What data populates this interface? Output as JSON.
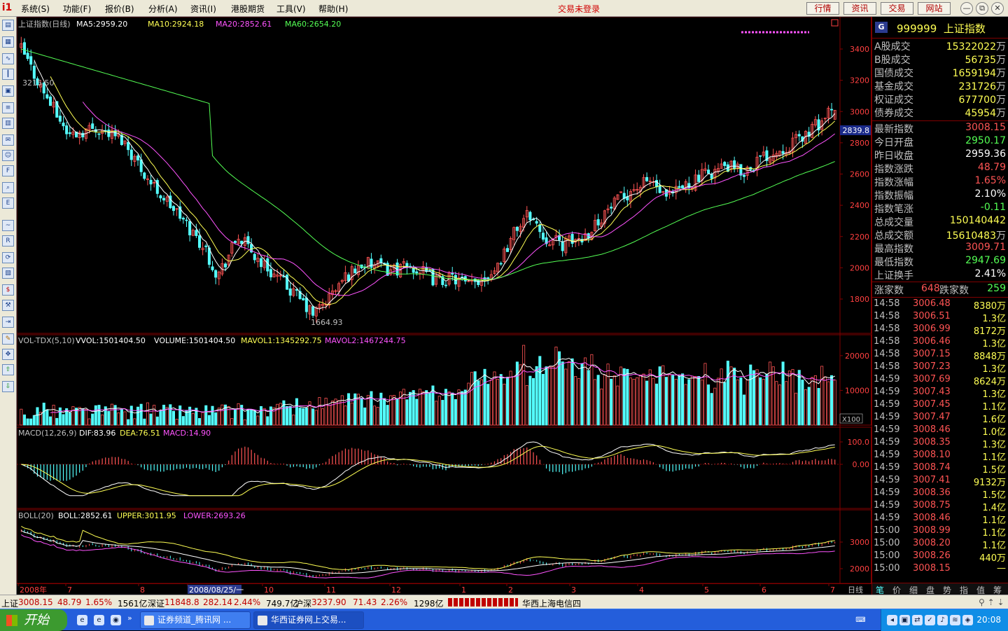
{
  "app": {
    "logo": "i1",
    "status": "交易未登录"
  },
  "menu": [
    "系统(S)",
    "功能(F)",
    "报价(B)",
    "分析(A)",
    "资讯(I)",
    "港股期货",
    "工具(V)",
    "帮助(H)"
  ],
  "top_buttons": [
    "行情",
    "资讯",
    "交易",
    "网站"
  ],
  "window_buttons": {
    "minimize": "—",
    "restore": "⧉",
    "close": "✕"
  },
  "charts": {
    "kline": {
      "title": "上证指数(日线)",
      "ma5": "MA5:2959.20",
      "ma10": "MA10:2924.18",
      "ma20": "MA20:2852.61",
      "ma60": "MA60:2654.20",
      "yticks": [
        "3400",
        "3200",
        "3000",
        "2800",
        "2600",
        "2400",
        "2200",
        "2000",
        "1800"
      ],
      "high_label": "3215.50",
      "low_label": "1664.93",
      "current_price": "2839.8"
    },
    "vol": {
      "title": "VOL-TDX(5,10)",
      "vvol": "VVOL:1501404.50",
      "volume": "VOLUME:1501404.50",
      "mavol1": "MAVOL1:1345292.75",
      "mavol2": "MAVOL2:1467244.75",
      "yticks": [
        "20000",
        "10000"
      ],
      "unit": "X100"
    },
    "macd": {
      "title": "MACD(12,26,9)",
      "dif": "DIF:83.96",
      "dea": "DEA:76.51",
      "macd": "MACD:14.90",
      "yticks": [
        "100.0",
        "0.00"
      ]
    },
    "boll": {
      "title": "BOLL(20)",
      "boll": "BOLL:2852.61",
      "upper": "UPPER:3011.95",
      "lower": "LOWER:2693.26",
      "yticks": [
        "3000",
        "2000"
      ]
    },
    "xaxis": {
      "labels": [
        "2008年",
        "7",
        "8",
        "2008/08/25/一",
        "10",
        "11",
        "12",
        "1",
        "2",
        "3",
        "4",
        "5",
        "6",
        "7"
      ],
      "period": "日线"
    }
  },
  "panel": {
    "code": "999999",
    "name": "上证指数",
    "volumes": [
      {
        "label": "A股成交",
        "value": "15322022",
        "unit": "万"
      },
      {
        "label": "B股成交",
        "value": "56735",
        "unit": "万"
      },
      {
        "label": "国债成交",
        "value": "1659194",
        "unit": "万"
      },
      {
        "label": "基金成交",
        "value": "231726",
        "unit": "万"
      },
      {
        "label": "权证成交",
        "value": "677700",
        "unit": "万"
      },
      {
        "label": "债券成交",
        "value": "45954",
        "unit": "万"
      }
    ],
    "stats": [
      {
        "label": "最新指数",
        "value": "3008.15",
        "color": "#ff5454"
      },
      {
        "label": "今日开盘",
        "value": "2950.17",
        "color": "#54ff54"
      },
      {
        "label": "昨日收盘",
        "value": "2959.36",
        "color": "#ffffff"
      },
      {
        "label": "指数涨跌",
        "value": "48.79",
        "color": "#ff5454"
      },
      {
        "label": "指数涨幅",
        "value": "1.65%",
        "color": "#ff5454"
      },
      {
        "label": "指数振幅",
        "value": "2.10%",
        "color": "#ffffff"
      },
      {
        "label": "指数笔涨",
        "value": "-0.11",
        "color": "#54ff54"
      },
      {
        "label": "总成交量",
        "value": "150140442",
        "color": "#ffff54"
      },
      {
        "label": "总成交额",
        "value": "15610483",
        "unit": "万",
        "color": "#ffff54"
      },
      {
        "label": "最高指数",
        "value": "3009.71",
        "color": "#ff5454"
      },
      {
        "label": "最低指数",
        "value": "2947.69",
        "color": "#54ff54"
      },
      {
        "label": "上证换手",
        "value": "2.41%",
        "color": "#ffffff"
      }
    ],
    "updown": {
      "up_label": "涨家数",
      "up": "648",
      "down_label": "跌家数",
      "down": "259"
    },
    "ticks": [
      {
        "t": "14:58",
        "p": "3006.48",
        "q": "8380万"
      },
      {
        "t": "14:58",
        "p": "3006.51",
        "q": "1.3亿"
      },
      {
        "t": "14:58",
        "p": "3006.99",
        "q": "8172万"
      },
      {
        "t": "14:58",
        "p": "3006.46",
        "q": "1.3亿"
      },
      {
        "t": "14:58",
        "p": "3007.15",
        "q": "8848万"
      },
      {
        "t": "14:58",
        "p": "3007.23",
        "q": "1.3亿"
      },
      {
        "t": "14:59",
        "p": "3007.69",
        "q": "8624万"
      },
      {
        "t": "14:59",
        "p": "3007.43",
        "q": "1.3亿"
      },
      {
        "t": "14:59",
        "p": "3007.45",
        "q": "1.1亿"
      },
      {
        "t": "14:59",
        "p": "3007.47",
        "q": "1.6亿"
      },
      {
        "t": "14:59",
        "p": "3008.46",
        "q": "1.0亿"
      },
      {
        "t": "14:59",
        "p": "3008.35",
        "q": "1.3亿"
      },
      {
        "t": "14:59",
        "p": "3008.10",
        "q": "1.1亿"
      },
      {
        "t": "14:59",
        "p": "3008.74",
        "q": "1.5亿"
      },
      {
        "t": "14:59",
        "p": "3007.41",
        "q": "9132万"
      },
      {
        "t": "14:59",
        "p": "3008.36",
        "q": "1.5亿"
      },
      {
        "t": "14:59",
        "p": "3008.75",
        "q": "1.4亿"
      },
      {
        "t": "14:59",
        "p": "3008.46",
        "q": "1.1亿"
      },
      {
        "t": "15:00",
        "p": "3008.99",
        "q": "1.1亿"
      },
      {
        "t": "15:00",
        "p": "3008.20",
        "q": "1.1亿"
      },
      {
        "t": "15:00",
        "p": "3008.26",
        "q": "440万"
      },
      {
        "t": "15:00",
        "p": "3008.15",
        "q": "—"
      }
    ],
    "tabs": [
      "笔",
      "价",
      "细",
      "盘",
      "势",
      "指",
      "值",
      "筹"
    ]
  },
  "statusbar": {
    "sh_label": "上证",
    "sh_price": "3008.15",
    "sh_change": "48.79",
    "sh_pct": "1.65%",
    "sh_amount": "1561亿",
    "sz_label": "深证",
    "sz_price": "11848.8",
    "sz_change": "282.14",
    "sz_pct": "2.44%",
    "sz_amount": "749.7亿",
    "hs_label": "沪深",
    "hs_price": "3237.90",
    "hs_change": "71.43",
    "hs_pct": "2.26%",
    "hs_amount": "1298亿",
    "server": "华西上海电信四"
  },
  "taskbar": {
    "start": "开始",
    "tasks": [
      "证券频道_腾讯网 ...",
      "华西证券网上交易..."
    ],
    "clock": "20:08"
  },
  "colors": {
    "up": "#ff5454",
    "down": "#54ffff",
    "ma5": "#ffffff",
    "ma10": "#ffff54",
    "ma20": "#ff54ff",
    "ma60": "#54ff54",
    "grid": "#800000"
  }
}
